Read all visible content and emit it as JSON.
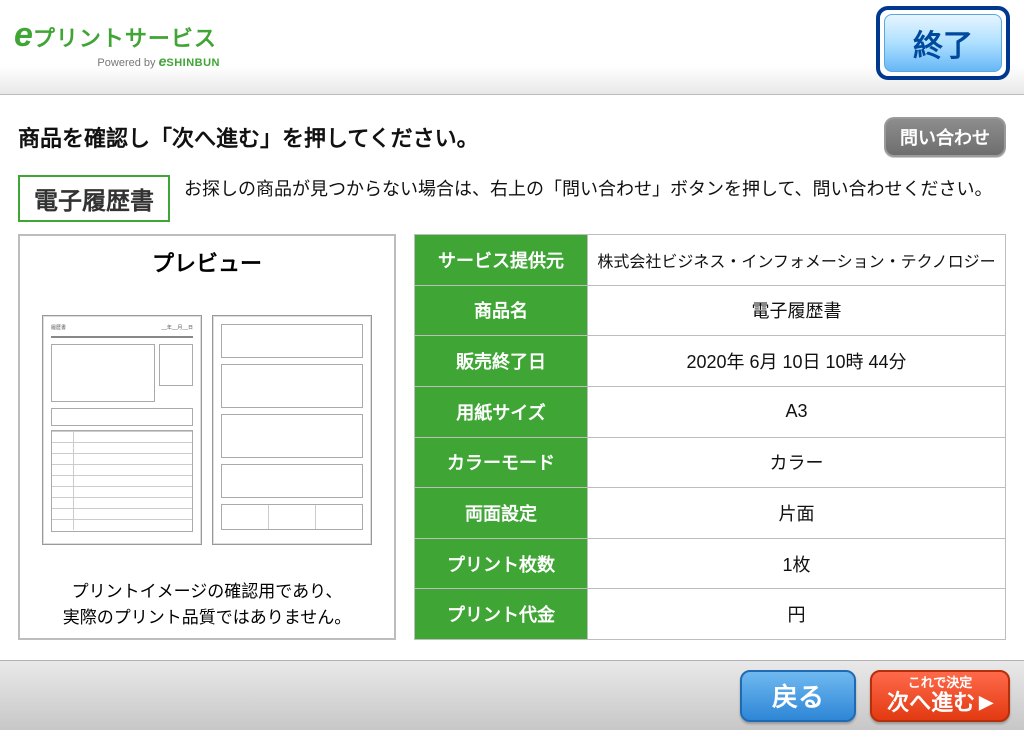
{
  "logo": {
    "main": "プリントサービス",
    "powered": "Powered by",
    "brand": "SHINBUN"
  },
  "header": {
    "exit": "終了"
  },
  "subhead": {
    "instruction": "商品を確認し「次へ進む」を押してください。",
    "inquiry": "問い合わせ"
  },
  "category": "電子履歴書",
  "hint": "お探しの商品が見つからない場合は、右上の「問い合わせ」ボタンを押して、問い合わせください。",
  "preview": {
    "title": "プレビュー",
    "note1": "プリントイメージの確認用であり、",
    "note2": "実際のプリント品質ではありません。"
  },
  "details": {
    "rows": [
      {
        "label": "サービス提供元",
        "value": "株式会社ビジネス・インフォメーション・テクノロジー"
      },
      {
        "label": "商品名",
        "value": "電子履歴書"
      },
      {
        "label": "販売終了日",
        "value": "2020年 6月 10日 10時 44分"
      },
      {
        "label": "用紙サイズ",
        "value": "A3"
      },
      {
        "label": "カラーモード",
        "value": "カラー"
      },
      {
        "label": "両面設定",
        "value": "片面"
      },
      {
        "label": "プリント枚数",
        "value": "1枚"
      },
      {
        "label": "プリント代金",
        "value": "円"
      }
    ]
  },
  "footer": {
    "back": "戻る",
    "next_small": "これで決定",
    "next_big": "次へ進む"
  }
}
